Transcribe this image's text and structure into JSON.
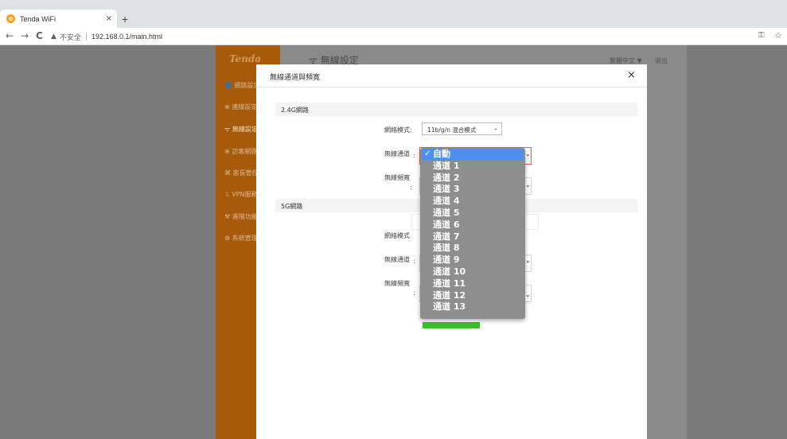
{
  "browser": {
    "tab_title": "Tenda WiFi",
    "tab_close": "×",
    "new_tab": "+",
    "back": "←",
    "forward": "→",
    "reload": "C",
    "insecure_label": "不安全",
    "url": "192.168.0.1/main.html"
  },
  "sidebar": {
    "logo": "Tenda",
    "items": [
      {
        "label": "網路設定"
      },
      {
        "label": "連線設定"
      },
      {
        "label": "無線設定"
      },
      {
        "label": "訪客網路"
      },
      {
        "label": "家長管控"
      },
      {
        "label": "VPN服務"
      },
      {
        "label": "進階功能"
      },
      {
        "label": "系統管理"
      }
    ]
  },
  "header": {
    "title": "無線設定",
    "language": "繁體中文 ▼",
    "logout": "退出"
  },
  "modal": {
    "title": "無線通道與頻寬",
    "close": "×",
    "section_24g": "2.4G網路",
    "section_5g": "5G網路",
    "mode_label": "網絡模式:",
    "mode_value": "11b/g/n 混合模式",
    "channel_label": "無線通道",
    "bandwidth_label": "無線頻寬",
    "mode_label_5g": "網絡模式",
    "channel_label_5g": "無線通道",
    "bandwidth_label_5g": "無線頻寬",
    "colon": ":"
  },
  "dropdown": {
    "options": [
      {
        "label": "自動",
        "selected": true
      },
      {
        "label": "通道 1"
      },
      {
        "label": "通道 2"
      },
      {
        "label": "通道 3"
      },
      {
        "label": "通道 4"
      },
      {
        "label": "通道 5"
      },
      {
        "label": "通道 6"
      },
      {
        "label": "通道 7"
      },
      {
        "label": "通道 8"
      },
      {
        "label": "通道 9"
      },
      {
        "label": "通道 10"
      },
      {
        "label": "通道 11"
      },
      {
        "label": "通道 12"
      },
      {
        "label": "通道 13"
      }
    ],
    "check": "✓"
  },
  "colors": {
    "sidebar": "#a75a0a",
    "selected_option": "#4d8ff0",
    "save_button": "#3bbd2c"
  }
}
